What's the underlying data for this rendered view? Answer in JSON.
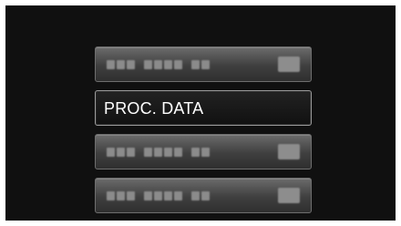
{
  "menu": {
    "items": [
      {
        "label": "",
        "selected": false,
        "icon": "settings-icon"
      },
      {
        "label": "PROC. DATA",
        "selected": true
      },
      {
        "label": "",
        "selected": false,
        "icon": "settings-icon"
      },
      {
        "label": "",
        "selected": false,
        "icon": "settings-icon"
      }
    ]
  }
}
